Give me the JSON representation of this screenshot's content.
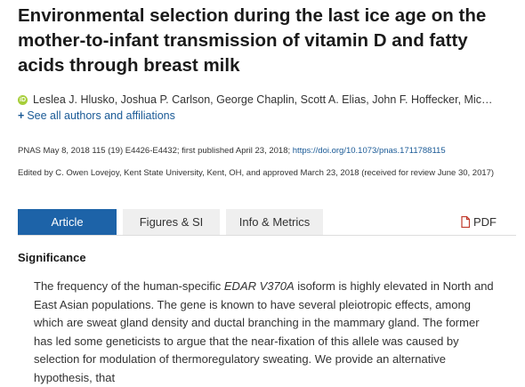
{
  "article": {
    "title": "Environmental selection during the last ice age on the mother-to-infant transmission of vitamin D and fatty acids through breast milk",
    "authors": "Leslea J. Hlusko, Joshua P. Carlson, George Chaplin, Scott A. Elias, John F. Hoffecker, Mic…",
    "orcid_label": "iD",
    "see_all_label": "See all authors and affiliations",
    "citation_prefix": "PNAS May 8, 2018 115 (19) E4426-E4432; first published April 23, 2018; ",
    "doi": "https://doi.org/10.1073/pnas.1711788115",
    "edited_by": "Edited by C. Owen Lovejoy, Kent State University, Kent, OH, and approved March 23, 2018 (received for review June 30, 2017)"
  },
  "tabs": [
    {
      "label": "Article",
      "active": true
    },
    {
      "label": "Figures & SI",
      "active": false
    },
    {
      "label": "Info & Metrics",
      "active": false
    }
  ],
  "pdf_label": "PDF",
  "section": {
    "heading": "Significance",
    "text_before_em": "The frequency of the human-specific ",
    "em": "EDAR V370A",
    "text_after_em": " isoform is highly elevated in North and East Asian populations. The gene is known to have several pleiotropic effects, among which are sweat gland density and ductal branching in the mammary gland. The former has led some geneticists to argue that the near-fixation of this allele was caused by selection for modulation of thermoregulatory sweating. We provide an alternative hypothesis, that"
  },
  "colors": {
    "accent": "#1d63a8",
    "link": "#1a5a96",
    "pdf_icon": "#c0392b",
    "orcid": "#a6ce39",
    "tab_inactive": "#efefef"
  },
  "icons": {
    "orcid": "orcid-icon",
    "plus": "plus-icon",
    "pdf": "pdf-file-icon"
  }
}
